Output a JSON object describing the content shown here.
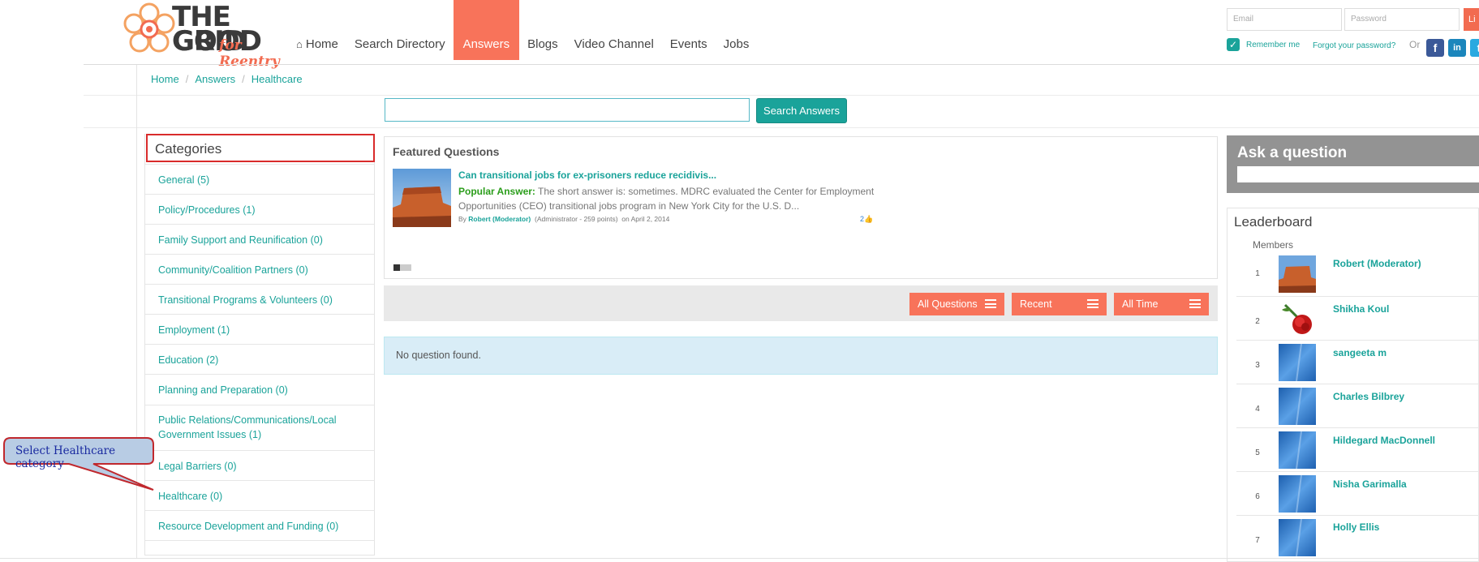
{
  "logo": {
    "line1": "THE GOOD",
    "line2": "GRID",
    "line3": "for Reentry"
  },
  "nav": {
    "items": [
      {
        "label": "Home"
      },
      {
        "label": "Search Directory"
      },
      {
        "label": "Answers"
      },
      {
        "label": "Blogs"
      },
      {
        "label": "Video Channel"
      },
      {
        "label": "Events"
      },
      {
        "label": "Jobs"
      }
    ],
    "active": "Answers"
  },
  "login": {
    "email_placeholder": "Email",
    "password_placeholder": "Password",
    "button_label": "Li",
    "remember_label": "Remember me",
    "forgot_label": "Forgot your password?",
    "or_label": "Or",
    "social": [
      {
        "name": "facebook-icon",
        "glyph": "f",
        "color": "#3b5998"
      },
      {
        "name": "linkedin-icon",
        "glyph": "in",
        "color": "#1b86bc"
      },
      {
        "name": "twitter-icon",
        "glyph": "t",
        "color": "#2aa9e0"
      }
    ]
  },
  "breadcrumb": {
    "items": [
      "Home",
      "Answers",
      "Healthcare"
    ],
    "separator": "/"
  },
  "search": {
    "value": "",
    "button_label": "Search Answers"
  },
  "categories": {
    "title": "Categories",
    "items": [
      "General (5)",
      "Policy/Procedures (1)",
      "Family Support and Reunification (0)",
      "Community/Coalition Partners (0)",
      "Transitional Programs & Volunteers (0)",
      "Employment (1)",
      "Education (2)",
      "Planning and Preparation (0)",
      "Public Relations/Communications/Local Government Issues (1)",
      "Legal Barriers (0)",
      "Healthcare (0)",
      "Resource Development and Funding (0)"
    ]
  },
  "featured": {
    "title": "Featured Questions",
    "question": "Can transitional jobs for ex-prisoners reduce recidivis...",
    "answer_label": "Popular Answer:",
    "answer_text": "The short answer is: sometimes. MDRC evaluated the Center for Employment Opportunities (CEO) transitional jobs program in New York City for the U.S. D...",
    "by_label": "By",
    "author": "Robert (Moderator)",
    "author_meta": "(Administrator - 259 points)",
    "date": "on April 2, 2014",
    "likes": "2"
  },
  "filters": [
    "All Questions",
    "Recent",
    "All Time"
  ],
  "no_questions": "No question found.",
  "ask": {
    "title": "Ask a question"
  },
  "leaderboard": {
    "title": "Leaderboard",
    "members_label": "Members",
    "rows": [
      {
        "rank": "1",
        "name": "Robert (Moderator)",
        "avatar": "rock"
      },
      {
        "rank": "2",
        "name": "Shikha Koul",
        "avatar": "rose"
      },
      {
        "rank": "3",
        "name": "sangeeta m",
        "avatar": "default"
      },
      {
        "rank": "4",
        "name": "Charles Bilbrey",
        "avatar": "default"
      },
      {
        "rank": "5",
        "name": "Hildegard MacDonnell",
        "avatar": "default"
      },
      {
        "rank": "6",
        "name": "Nisha Garimalla",
        "avatar": "default"
      },
      {
        "rank": "7",
        "name": "Holly Ellis",
        "avatar": "default"
      }
    ]
  },
  "callout": {
    "text": "Select Healthcare category"
  },
  "colors": {
    "accent": "#f8735a",
    "teal": "#1aa39a",
    "callout_fill": "#b8cce4",
    "callout_border": "#c0282d"
  }
}
